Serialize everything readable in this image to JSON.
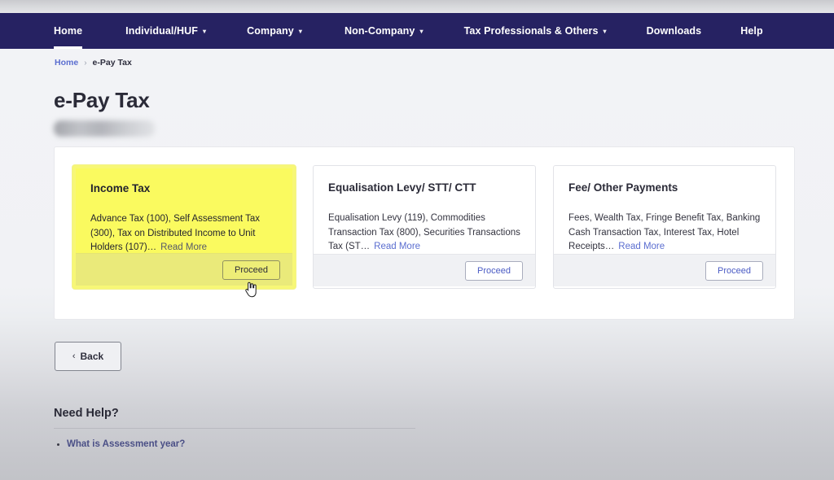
{
  "navbar": {
    "items": [
      {
        "label": "Home",
        "has_caret": false,
        "active": true
      },
      {
        "label": "Individual/HUF",
        "has_caret": true,
        "active": false
      },
      {
        "label": "Company",
        "has_caret": true,
        "active": false
      },
      {
        "label": "Non-Company",
        "has_caret": true,
        "active": false
      },
      {
        "label": "Tax Professionals & Others",
        "has_caret": true,
        "active": false
      },
      {
        "label": "Downloads",
        "has_caret": false,
        "active": false
      },
      {
        "label": "Help",
        "has_caret": false,
        "active": false
      }
    ],
    "background_color": "#262262"
  },
  "breadcrumb": {
    "home_label": "Home",
    "separator": "›",
    "current_label": "e-Pay Tax"
  },
  "page": {
    "title": "e-Pay Tax",
    "subtitle_redacted": true
  },
  "cards": [
    {
      "title": "Income Tax",
      "description": "Advance Tax (100), Self Assessment Tax (300), Tax on Distributed Income to Unit Holders (107)…",
      "read_more_label": "Read More",
      "proceed_label": "Proceed",
      "selected": true,
      "highlight_color": "#fafa5f"
    },
    {
      "title": "Equalisation Levy/ STT/ CTT",
      "description": "Equalisation Levy (119), Commodities Transaction Tax (800), Securities Transactions Tax (ST…",
      "read_more_label": "Read More",
      "proceed_label": "Proceed",
      "selected": false,
      "highlight_color": ""
    },
    {
      "title": "Fee/ Other Payments",
      "description": "Fees, Wealth Tax, Fringe Benefit Tax, Banking Cash Transaction Tax, Interest Tax, Hotel Receipts…",
      "read_more_label": "Read More",
      "proceed_label": "Proceed",
      "selected": false,
      "highlight_color": ""
    }
  ],
  "back_button": {
    "label": "Back",
    "chevron": "‹"
  },
  "need_help": {
    "heading": "Need Help?",
    "links": [
      {
        "label": "What is Assessment year?"
      }
    ]
  },
  "colors": {
    "nav_background": "#262262",
    "link_blue": "#5b6ed0",
    "selected_yellow": "#fafa5f",
    "page_background": "#f2f3f6"
  }
}
